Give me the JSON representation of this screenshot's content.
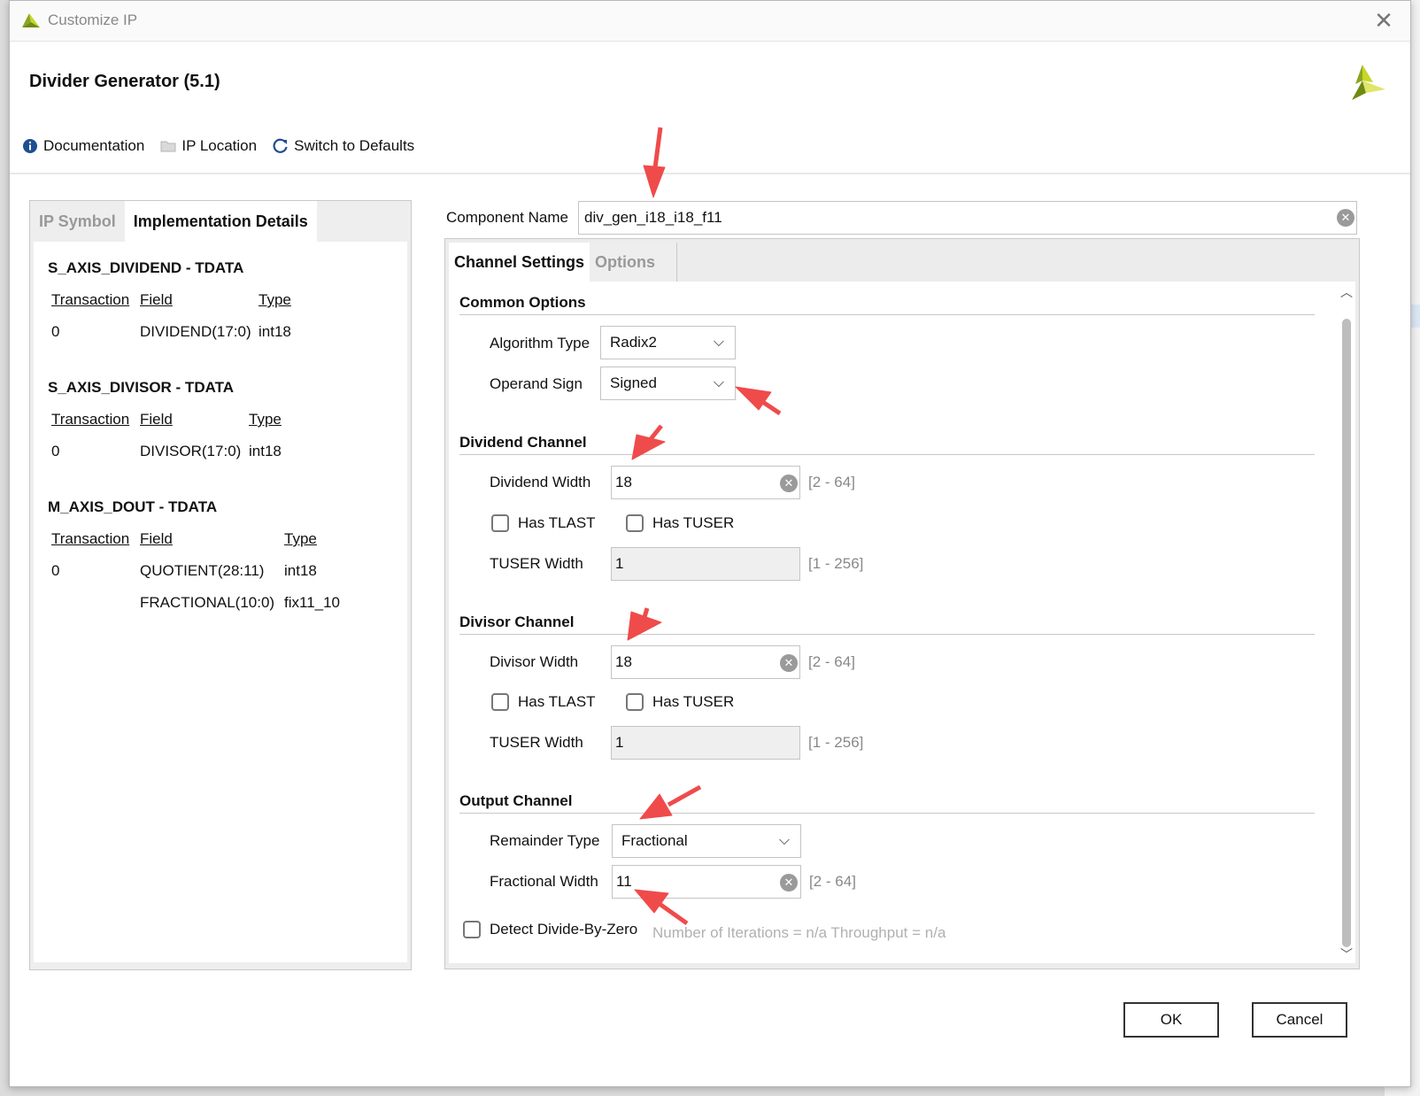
{
  "window": {
    "title": "Customize IP",
    "close_icon": "close-icon"
  },
  "header": {
    "title": "Divider Generator (5.1)"
  },
  "toolbar": {
    "documentation": "Documentation",
    "ip_location": "IP Location",
    "switch_defaults": "Switch to Defaults"
  },
  "left_tabs": {
    "ip_symbol": "IP Symbol",
    "impl_details": "Implementation Details"
  },
  "interfaces": [
    {
      "title": "S_AXIS_DIVIDEND - TDATA",
      "headers": [
        "Transaction",
        "Field",
        "Type"
      ],
      "rows": [
        [
          "0",
          "DIVIDEND(17:0)",
          "int18"
        ]
      ]
    },
    {
      "title": "S_AXIS_DIVISOR - TDATA",
      "headers": [
        "Transaction",
        "Field",
        "Type"
      ],
      "rows": [
        [
          "0",
          "DIVISOR(17:0)",
          "int18"
        ]
      ]
    },
    {
      "title": "M_AXIS_DOUT - TDATA",
      "headers": [
        "Transaction",
        "Field",
        "Type"
      ],
      "rows": [
        [
          "0",
          "QUOTIENT(28:11)",
          "int18"
        ],
        [
          "",
          "FRACTIONAL(10:0)",
          "fix11_10"
        ]
      ]
    }
  ],
  "component": {
    "label": "Component Name",
    "value": "div_gen_i18_i18_f11"
  },
  "right_tabs": {
    "channel_settings": "Channel Settings",
    "options": "Options"
  },
  "common": {
    "title": "Common Options",
    "algorithm_label": "Algorithm Type",
    "algorithm_value": "Radix2",
    "sign_label": "Operand Sign",
    "sign_value": "Signed"
  },
  "dividend": {
    "title": "Dividend Channel",
    "width_label": "Dividend Width",
    "width_value": "18",
    "width_range": "[2 - 64]",
    "tlast": "Has TLAST",
    "tuser": "Has TUSER",
    "tuser_width_label": "TUSER Width",
    "tuser_width_value": "1",
    "tuser_range": "[1 - 256]"
  },
  "divisor": {
    "title": "Divisor Channel",
    "width_label": "Divisor Width",
    "width_value": "18",
    "width_range": "[2 - 64]",
    "tlast": "Has TLAST",
    "tuser": "Has TUSER",
    "tuser_width_label": "TUSER Width",
    "tuser_width_value": "1",
    "tuser_range": "[1 - 256]"
  },
  "output": {
    "title": "Output Channel",
    "remainder_label": "Remainder Type",
    "remainder_value": "Fractional",
    "frac_label": "Fractional Width",
    "frac_value": "11",
    "frac_range": "[2 - 64]"
  },
  "detect": {
    "label": "Detect Divide-By-Zero",
    "hint": "Number of Iterations = n/a  Throughput = n/a"
  },
  "buttons": {
    "ok": "OK",
    "cancel": "Cancel"
  },
  "colors": {
    "accent_arrow": "#ef4b4b",
    "logo_green": "#8aa51e",
    "logo_yellow": "#c8d62a"
  }
}
